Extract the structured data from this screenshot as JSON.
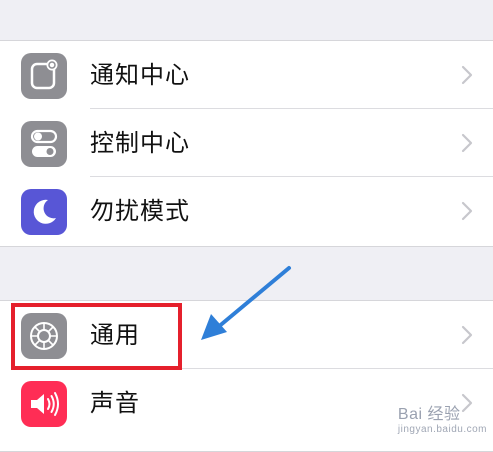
{
  "settings": {
    "group1": [
      {
        "label": "通知中心",
        "icon": "notification-center-icon"
      },
      {
        "label": "控制中心",
        "icon": "control-center-icon"
      },
      {
        "label": "勿扰模式",
        "icon": "do-not-disturb-moon-icon"
      }
    ],
    "group2": [
      {
        "label": "通用",
        "icon": "general-gear-icon"
      },
      {
        "label": "声音",
        "icon": "sound-speaker-icon"
      }
    ]
  },
  "colors": {
    "background": "#efeff4",
    "gray_icon": "#8e8e93",
    "moon_icon": "#5856d6",
    "sound_icon": "#ff2d55",
    "highlight": "#e5202c",
    "arrow": "#2f7fd8"
  },
  "watermark": {
    "text": "Bai 经验",
    "sub": "jingyan.baidu.com"
  }
}
